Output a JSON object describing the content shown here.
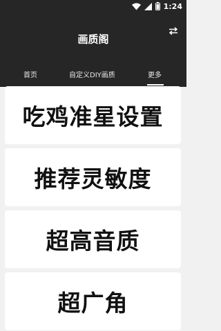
{
  "status_bar": {
    "time": "1:24",
    "icons": [
      "wifi-icon",
      "signal-icon",
      "battery-icon"
    ]
  },
  "app_bar": {
    "title": "画质阁",
    "action_icon": "swap-arrows-icon"
  },
  "tabs": [
    {
      "label": "首页",
      "selected": false
    },
    {
      "label": "自定义DIY画质",
      "selected": false
    },
    {
      "label": "更多",
      "selected": true
    }
  ],
  "cards": [
    {
      "label": "吃鸡准星设置"
    },
    {
      "label": "推荐灵敏度"
    },
    {
      "label": "超高音质"
    },
    {
      "label": "超广角"
    }
  ],
  "colors": {
    "header_bg": "#262626",
    "page_bg": "#f1f1f1",
    "card_bg": "#ffffff",
    "card_text": "#111111"
  }
}
